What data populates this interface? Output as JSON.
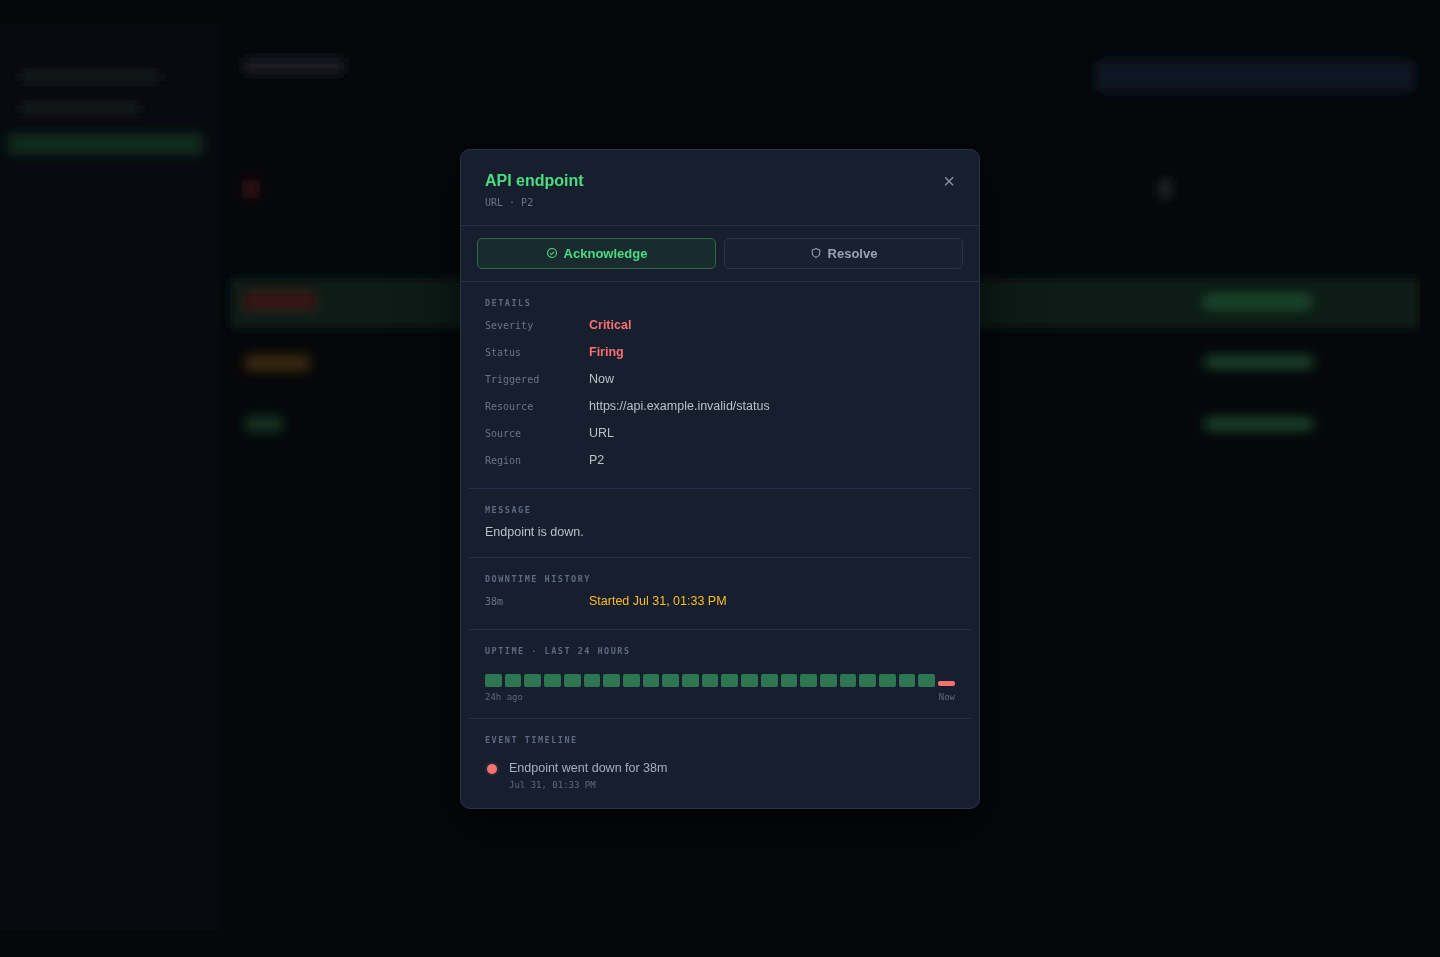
{
  "modal": {
    "title": "API endpoint",
    "subtitle": "URL · P2",
    "close": "×",
    "actions": [
      {
        "label": "Acknowledge",
        "kind": "acknowledge"
      },
      {
        "label": "Resolve",
        "kind": "resolve"
      }
    ],
    "details": {
      "heading": "DETAILS",
      "rows": [
        {
          "label": "Severity",
          "value": "Critical",
          "color": "#f87171"
        },
        {
          "label": "Status",
          "value": "Firing",
          "color": "#f87171"
        },
        {
          "label": "Triggered",
          "value": "Now",
          "color": "#b8c0cc"
        },
        {
          "label": "Resource",
          "value": "https://api.example.invalid/status",
          "color": "#b8c0cc"
        },
        {
          "label": "Source",
          "value": "URL",
          "color": "#b8c0cc"
        },
        {
          "label": "Region",
          "value": "P2",
          "color": "#b8c0cc"
        }
      ]
    },
    "message": {
      "heading": "MESSAGE",
      "text": "Endpoint is down."
    },
    "downtime": {
      "heading": "DOWNTIME HISTORY",
      "rows": [
        {
          "duration": "38m",
          "value": "Started Jul 31, 01:33 PM",
          "color": "#fbbf24"
        }
      ]
    },
    "uptime": {
      "heading": "UPTIME · LAST 24 HOURS",
      "start_label": "24h ago",
      "end_label": "Now",
      "bars": [
        {
          "kind": "up"
        },
        {
          "kind": "up"
        },
        {
          "kind": "up"
        },
        {
          "kind": "up"
        },
        {
          "kind": "up"
        },
        {
          "kind": "up"
        },
        {
          "kind": "up"
        },
        {
          "kind": "up"
        },
        {
          "kind": "up"
        },
        {
          "kind": "up"
        },
        {
          "kind": "up"
        },
        {
          "kind": "up"
        },
        {
          "kind": "up"
        },
        {
          "kind": "up"
        },
        {
          "kind": "up"
        },
        {
          "kind": "up"
        },
        {
          "kind": "up"
        },
        {
          "kind": "up"
        },
        {
          "kind": "up"
        },
        {
          "kind": "up"
        },
        {
          "kind": "up"
        },
        {
          "kind": "up"
        },
        {
          "kind": "up"
        },
        {
          "kind": "down"
        }
      ]
    },
    "timeline": {
      "heading": "EVENT TIMELINE",
      "events": [
        {
          "text": "Endpoint went down for 38m",
          "time": "Jul 31, 01:33 PM",
          "color": "#f87171"
        }
      ]
    }
  }
}
